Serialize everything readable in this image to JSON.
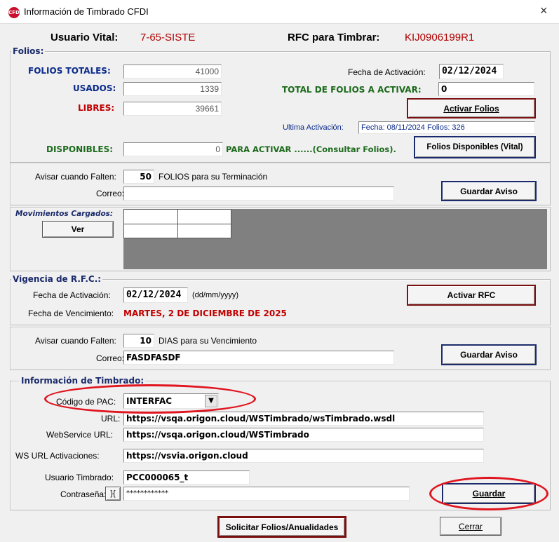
{
  "window": {
    "title": "Información de Timbrado CFDI",
    "icon": "app-logo-icon",
    "close": "×"
  },
  "header": {
    "user_label": "Usuario Vital:",
    "user_value": "7-65-SISTE",
    "rfc_label": "RFC para Timbrar:",
    "rfc_value": "KIJ0906199R1"
  },
  "folios": {
    "legend": "Folios:",
    "totales_label": "FOLIOS TOTALES:",
    "totales_value": "41000",
    "usados_label": "USADOS:",
    "usados_value": "1339",
    "libres_label": "LIBRES:",
    "libres_value": "39661",
    "fecha_act_label": "Fecha de Activación:",
    "fecha_act_value": "02/12/2024",
    "total_activar_label": "TOTAL DE FOLIOS A ACTIVAR:",
    "total_activar_value": "0",
    "activar_btn": "Activar Folios",
    "ultima_label": "Ultima Activación:",
    "ultima_value": "Fecha: 08/11/2024  Folios: 326",
    "disponibles_label": "DISPONIBLES:",
    "disponibles_value": "0",
    "para_activar": "PARA ACTIVAR ......(Consultar Folios).",
    "disponibles_btn": "Folios Disponibles (Vital)"
  },
  "aviso_folios": {
    "label": "Avisar cuando Falten:",
    "value": "50",
    "suffix": "FOLIOS para su Terminación",
    "correo_label": "Correo:",
    "correo_value": "",
    "guardar_btn": "Guardar Aviso"
  },
  "movimientos": {
    "label": "Movimientos Cargados:",
    "ver_btn": "Ver"
  },
  "vigencia": {
    "legend": "Vigencia de R.F.C.:",
    "fecha_act_label": "Fecha de Activación:",
    "fecha_act_value": "02/12/2024",
    "fecha_format": "(dd/mm/yyyy)",
    "fecha_venc_label": "Fecha de Vencimiento:",
    "fecha_venc_value": "MARTES, 2 DE DICIEMBRE DE 2025",
    "activar_btn": "Activar RFC"
  },
  "aviso_rfc": {
    "label": "Avisar cuando Falten:",
    "value": "10",
    "suffix": "DIAS para su Vencimiento",
    "correo_label": "Correo:",
    "correo_value": "FASDFASDF",
    "guardar_btn": "Guardar Aviso"
  },
  "timbrado": {
    "legend": "Información de Timbrado:",
    "pac_label": "Código de PAC:",
    "pac_value": "INTERFAC",
    "url_label": "URL:",
    "url_value": "https://vsqa.origon.cloud/WSTimbrado/wsTimbrado.wsdl",
    "ws_label": "WebService URL:",
    "ws_value": "https://vsqa.origon.cloud/WSTimbrado",
    "wsact_label": "WS URL Activaciones:",
    "wsact_value": "https://vsvia.origon.cloud",
    "usuario_label": "Usuario Timbrado:",
    "usuario_value": "PCC000065_t",
    "pass_label": "Contraseña:",
    "pass_toggle": "}{",
    "pass_value": "************",
    "guardar_btn": "Guardar"
  },
  "footer": {
    "solicitar_btn": "Solicitar Folios/Anualidades",
    "cerrar_btn": "Cerrar"
  },
  "colors": {
    "annotation": "#e0151f",
    "label_blue": "#0a2a8a",
    "label_red": "#b00000",
    "label_green": "#1c6a1c"
  }
}
